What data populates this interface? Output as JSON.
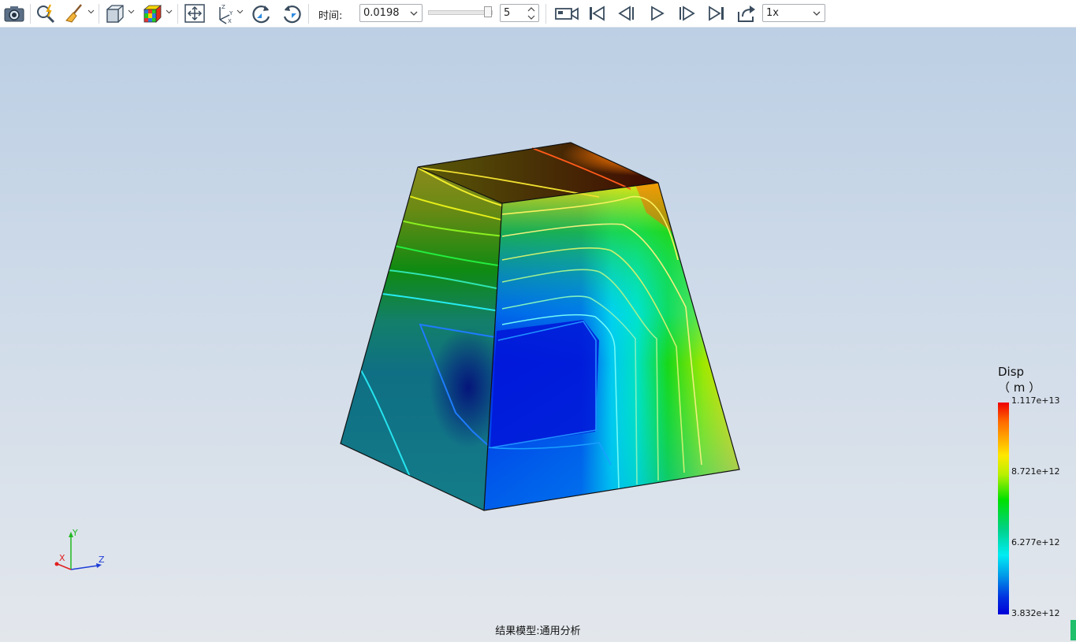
{
  "toolbar": {
    "icons": [
      "camera-icon",
      "zoom-icon",
      "broom-icon",
      "cube-view-icon",
      "color-cube-icon",
      "fit-view-icon",
      "axes-icon",
      "rotate-cw-icon",
      "rotate-ccw-icon"
    ],
    "time_label": "时间:",
    "time_value": "0.0198",
    "frame_value": "5",
    "speed_value": "1x",
    "playback_icons": [
      "record-video-icon",
      "first-frame-icon",
      "previous-frame-icon",
      "play-icon",
      "next-frame-icon",
      "last-frame-icon",
      "export-icon"
    ]
  },
  "legend": {
    "title": "Disp",
    "unit": "（ m ）",
    "max": "1.117e+13",
    "v2": "8.721e+12",
    "v3": "6.277e+12",
    "min": "3.832e+12",
    "colors": [
      "#ee0000",
      "#ffe800",
      "#00e000",
      "#00ecf4",
      "#0000d8"
    ]
  },
  "triad": {
    "x": "X",
    "y": "Y",
    "z": "Z"
  },
  "status_text": "结果模型:通用分析",
  "colors": {
    "viewport_top": "#bccfe4",
    "viewport_bottom": "#e3e7ec",
    "status_mark": "#1fbf6b"
  }
}
